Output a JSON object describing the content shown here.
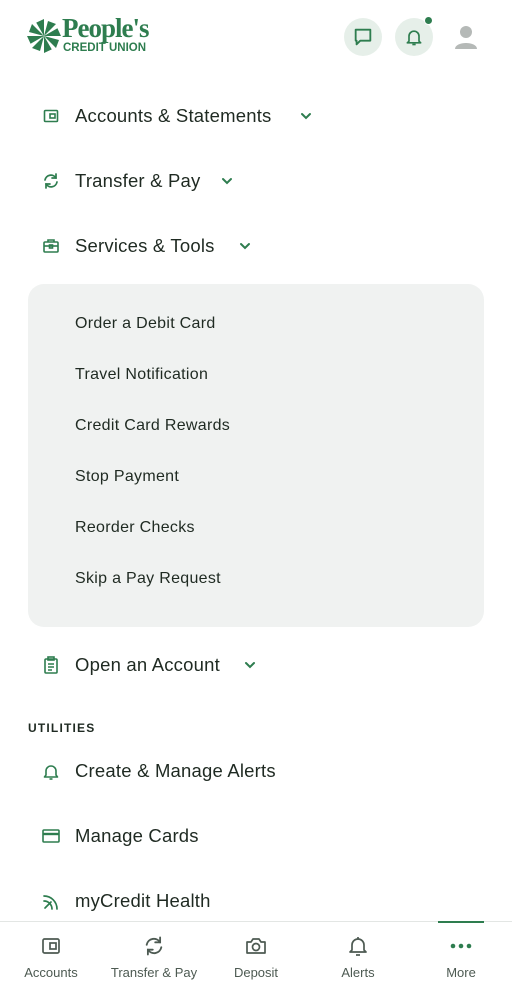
{
  "brand": {
    "name": "People's",
    "subtitle": "CREDIT UNION",
    "color": "#2e7d4f"
  },
  "header": {
    "chat_icon": "chat-bubble-icon",
    "bell_icon": "bell-icon",
    "profile_icon": "user-silhouette-icon",
    "has_unread_notifications": true
  },
  "menu": {
    "accounts": "Accounts & Statements",
    "transfer": "Transfer & Pay",
    "services": "Services & Tools",
    "services_items": [
      "Order a Debit Card",
      "Travel Notification",
      "Credit Card Rewards",
      "Stop Payment",
      "Reorder Checks",
      "Skip a Pay Request"
    ],
    "open_account": "Open an Account"
  },
  "utilities": {
    "heading": "UTILITIES",
    "alerts": "Create & Manage Alerts",
    "cards": "Manage Cards",
    "credit_health": "myCredit Health"
  },
  "tabbar": {
    "tabs": [
      "Accounts",
      "Transfer & Pay",
      "Deposit",
      "Alerts",
      "More"
    ],
    "active": "More"
  }
}
